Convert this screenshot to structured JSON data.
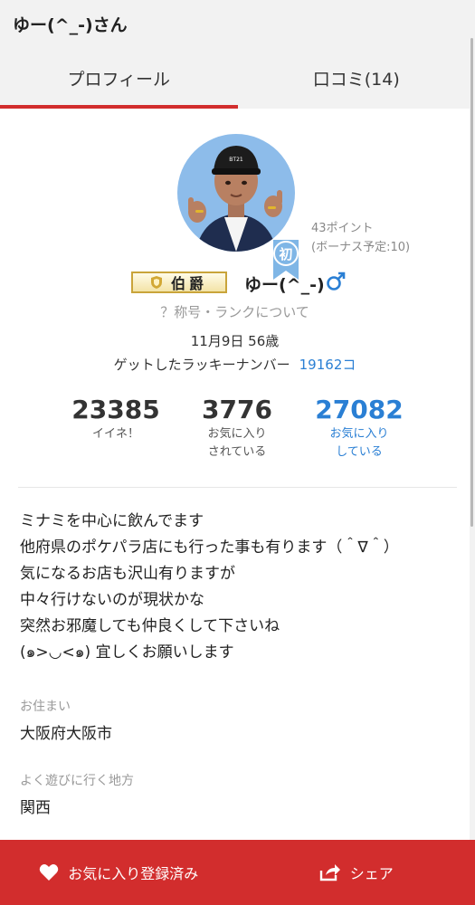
{
  "header": {
    "title": "ゆー(^_-)さん"
  },
  "tabs": [
    {
      "label": "プロフィール",
      "active": true
    },
    {
      "label": "口コミ(14)",
      "active": false
    }
  ],
  "profile": {
    "first_badge": "初",
    "points": "43ポイント",
    "bonus": "(ボーナス予定:10)",
    "rank_title": "伯爵",
    "nickname": "ゆー(^_-)",
    "gender_icon": "male-icon",
    "rank_about": "？称号・ランクについて",
    "birthday_age": "11月9日 56歳",
    "lucky_label": "ゲットしたラッキーナンバー",
    "lucky_value": "19162コ"
  },
  "stats": [
    {
      "value": "23385",
      "label_1": "イイネ！",
      "label_2": ""
    },
    {
      "value": "3776",
      "label_1": "お気に入り",
      "label_2": "されている"
    },
    {
      "value": "27082",
      "label_1": "お気に入り",
      "label_2": "している"
    }
  ],
  "bio": [
    "ミナミを中心に飲んでます",
    "他府県のポケパラ店にも行った事も有ります（＾∇＾）",
    "気になるお店も沢山有りますが",
    "中々行けないのが現状かな",
    "突然お邪魔しても仲良くして下さいね",
    "(๑>◡<๑) 宜しくお願いします"
  ],
  "residence": {
    "label": "お住まい",
    "value": "大阪府大阪市"
  },
  "area": {
    "label": "よく遊びに行く地方",
    "value": "関西"
  },
  "bottom_bar": {
    "favorite_label": "お気に入り登録済み",
    "share_label": "シェア"
  },
  "colors": {
    "accent": "#d22d2d",
    "link": "#2a7fd4",
    "avatar_bg": "#8dbcea"
  }
}
